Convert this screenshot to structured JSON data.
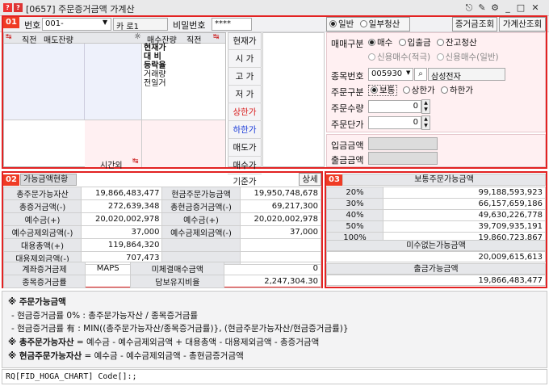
{
  "window": {
    "title": "[0657] 주문증거금액 가계산",
    "icon_q": "?",
    "icon_s": "?"
  },
  "toolbar": {
    "account_label": "번호",
    "account_value": "001-",
    "account_type": "카 로1",
    "pw_label": "비밀번호",
    "pw_value": "****",
    "mode_general": "일반",
    "mode_partial": "일부청산",
    "btn_margin": "증거금조회",
    "btn_calc": "가계산조회"
  },
  "badges": {
    "b1": "01",
    "b2": "02",
    "b3": "03"
  },
  "orderbook": {
    "h_direct": "직전",
    "h_sell": "매도잔량",
    "h_buy": "매수잔량",
    "h_direct2": "직전",
    "info_lines": [
      "현재가",
      "대 비",
      "등락율",
      "거래량",
      "전일거"
    ],
    "time_label": "시간외"
  },
  "side_list": [
    "현재가",
    "시 가",
    "고 가",
    "저 가",
    "상한가",
    "하한가",
    "매도가",
    "매수가",
    "기준가"
  ],
  "form": {
    "trade_label": "매매구분",
    "opt_buy": "매수",
    "opt_sellin": "입출금",
    "opt_clear": "잔고청산",
    "opt_credit_buy": "신용매수(적극)",
    "opt_credit_buy2": "신용매수(일반)",
    "code_label": "종목번호",
    "code_value": "005930",
    "stock_name": "삼성전자",
    "order_type_label": "주문구분",
    "opt_normal": "보통",
    "opt_upper": "상한가",
    "opt_lower": "하한가",
    "qty_label": "주문수량",
    "qty_value": "0",
    "price_label": "주문단가",
    "price_value": "0",
    "deposit_label": "입금금액",
    "withdraw_label": "출금금액"
  },
  "sec2": {
    "tab": "가능금액현황",
    "detail_btn": "상세",
    "rows": [
      {
        "l": "총주문가능자산",
        "lv": "19,866,483,477",
        "r": "현금주문가능금액",
        "rv": "19,950,748,678"
      },
      {
        "l": "총증거금액(-)",
        "lv": "272,639,348",
        "r": "총현금증거금액(-)",
        "rv": "69,217,300"
      },
      {
        "l": "예수금(+)",
        "lv": "20,020,002,978",
        "r": "예수금(+)",
        "rv": "20,020,002,978"
      },
      {
        "l": "예수금제외금액(-)",
        "lv": "37,000",
        "r": "예수금제외금액(-)",
        "rv": "37,000"
      },
      {
        "l": "대용총액(+)",
        "lv": "119,864,320",
        "r": "",
        "rv": ""
      },
      {
        "l": "대용제외금액(-)",
        "lv": "707,473",
        "r": "",
        "rv": ""
      }
    ],
    "rows2": [
      {
        "l": "계좌증거금제",
        "lv": "MAPS",
        "r": "미체결매수금액",
        "rv": "0"
      },
      {
        "l": "종목증거금률",
        "lv": "",
        "r": "담보유지비율",
        "rv": "2,247,304.30"
      }
    ]
  },
  "sec3": {
    "header": "보통주문가능금액",
    "rates": [
      {
        "p": "20%",
        "v": "99,188,593,923"
      },
      {
        "p": "30%",
        "v": "66,157,659,186"
      },
      {
        "p": "40%",
        "v": "49,630,226,778"
      },
      {
        "p": "50%",
        "v": "39,709,935,191"
      },
      {
        "p": "100%",
        "v": "19,860,723,867"
      }
    ],
    "no_margin_label": "미수없는가능금액",
    "no_margin_value": "20,009,615,613",
    "withdraw_label": "출금가능금액",
    "withdraw_value": "19,866,483,477"
  },
  "notes": {
    "title": "※ 주문가능금액",
    "l1": "- 현금증거금률 0% : 총주문가능자산 / 종목증거금률",
    "l2": "- 현금증거금률 有 : MIN((총주문가능자산/종목증거금률)}, (현금주문가능자산/현금증거금률)}",
    "l3a": "※ 총주문가능자산",
    "l3b": " = 예수금 - 예수금제외금액 + 대용총액 - 대용제외금액 - 총증거금액",
    "l4a": "※ 현금주문가능자산",
    "l4b": " = 예수금 - 예수금제외금액 - 총현금증거금액"
  },
  "status": {
    "text": "RQ[FID_HOGA_CHART] Code[]:;"
  },
  "colors": {
    "accent_red": "#e32222",
    "upper": "#d91f1f",
    "lower": "#1f3fd9"
  }
}
